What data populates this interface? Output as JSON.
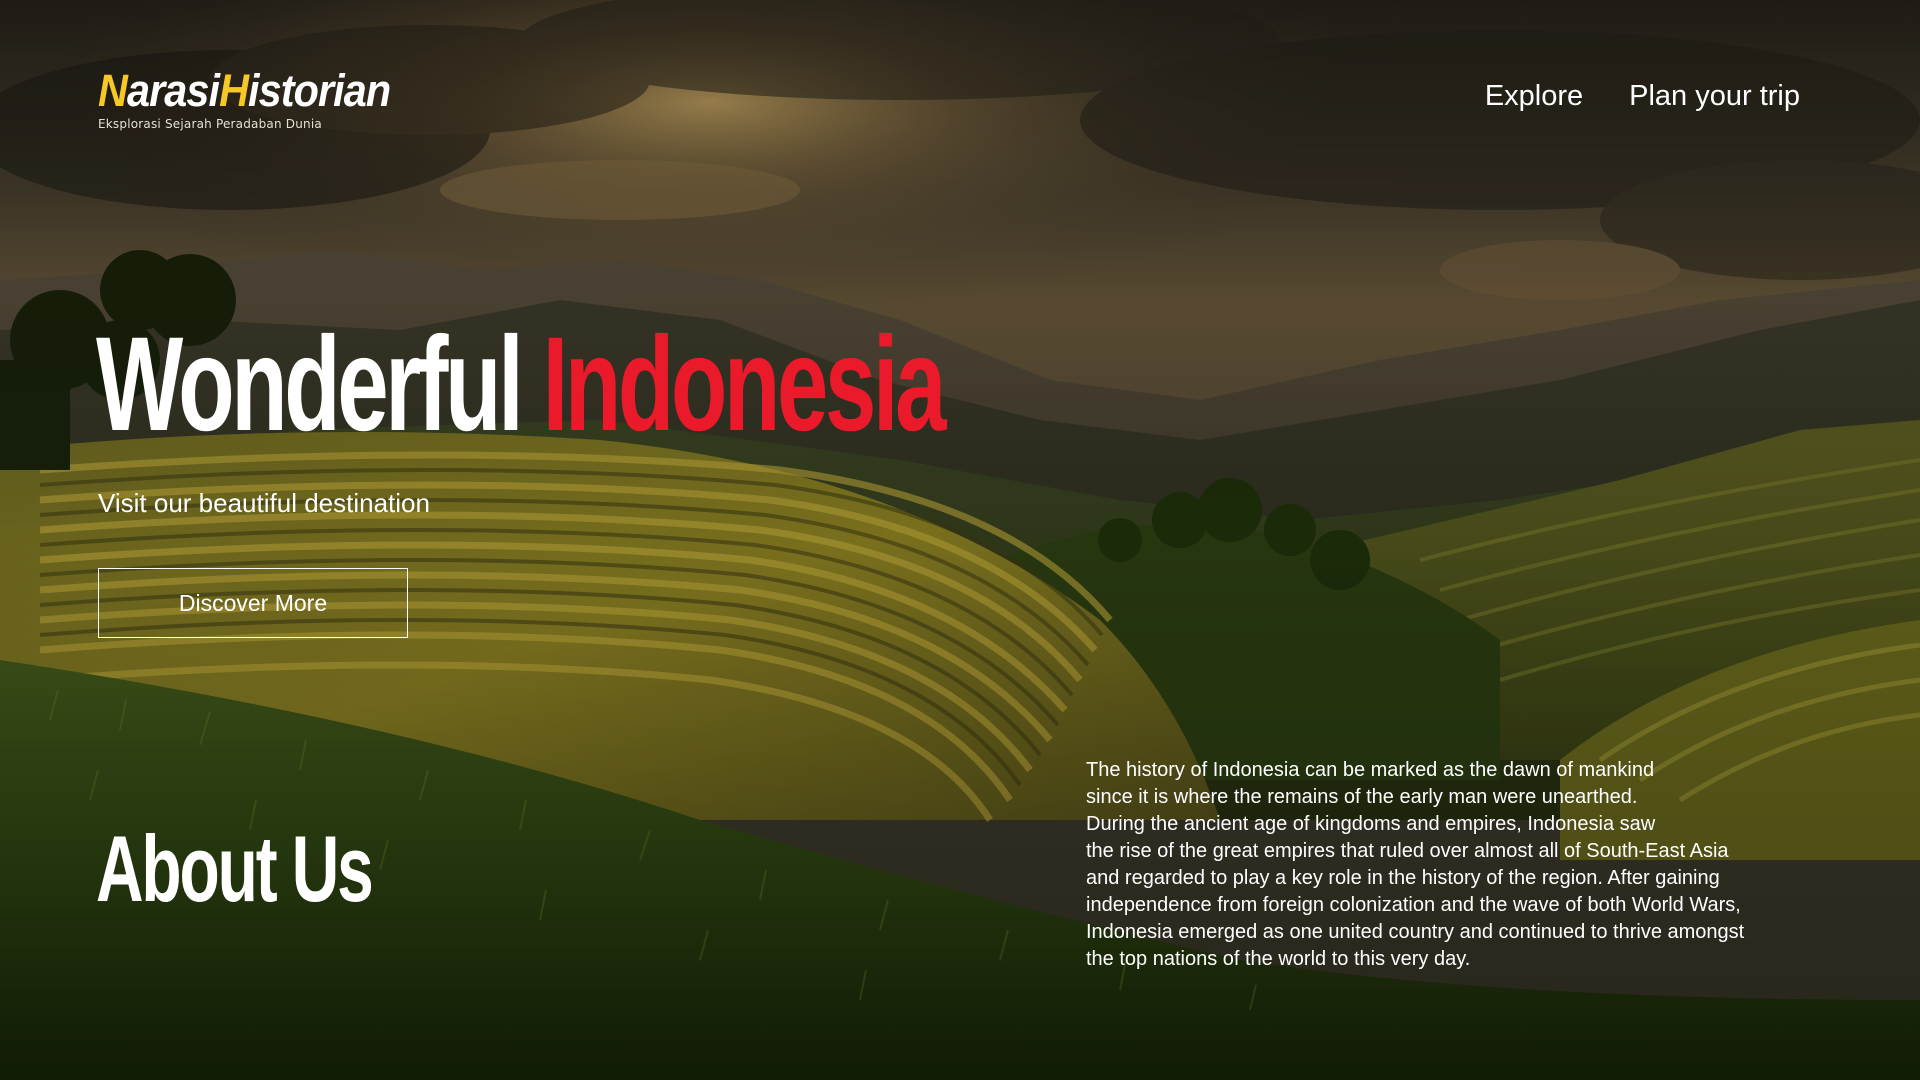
{
  "brand": {
    "name_part1": "N",
    "name_part2": "arasi",
    "name_part3": "H",
    "name_part4": "istorian",
    "tagline": "Eksplorasi Sejarah Peradaban Dunia",
    "accent_color": "#f7c825"
  },
  "nav": {
    "items": [
      {
        "label": "Explore"
      },
      {
        "label": "Plan your trip"
      }
    ]
  },
  "hero": {
    "title_part1": "Wonderful",
    "title_part2": "Indonesia",
    "title_accent_color": "#ea1a2b",
    "subtitle": "Visit our beautiful destination",
    "cta_label": "Discover More"
  },
  "about": {
    "title": "About Us",
    "lines": [
      "The history of Indonesia can be marked as the dawn of mankind",
      "since it is where the remains of the early man were unearthed.",
      "During the ancient age of kingdoms and empires, Indonesia saw",
      "the rise of the great empires that ruled over almost all of South-East Asia",
      "and regarded to play a key role in the history of the region. After gaining",
      "independence from foreign colonization and the wave of both World Wars,",
      "Indonesia emerged as one united country and continued to thrive amongst",
      "the top nations of the world to this very day."
    ]
  },
  "background": {
    "image": "rice-terraces-valley-sunset-photo"
  }
}
